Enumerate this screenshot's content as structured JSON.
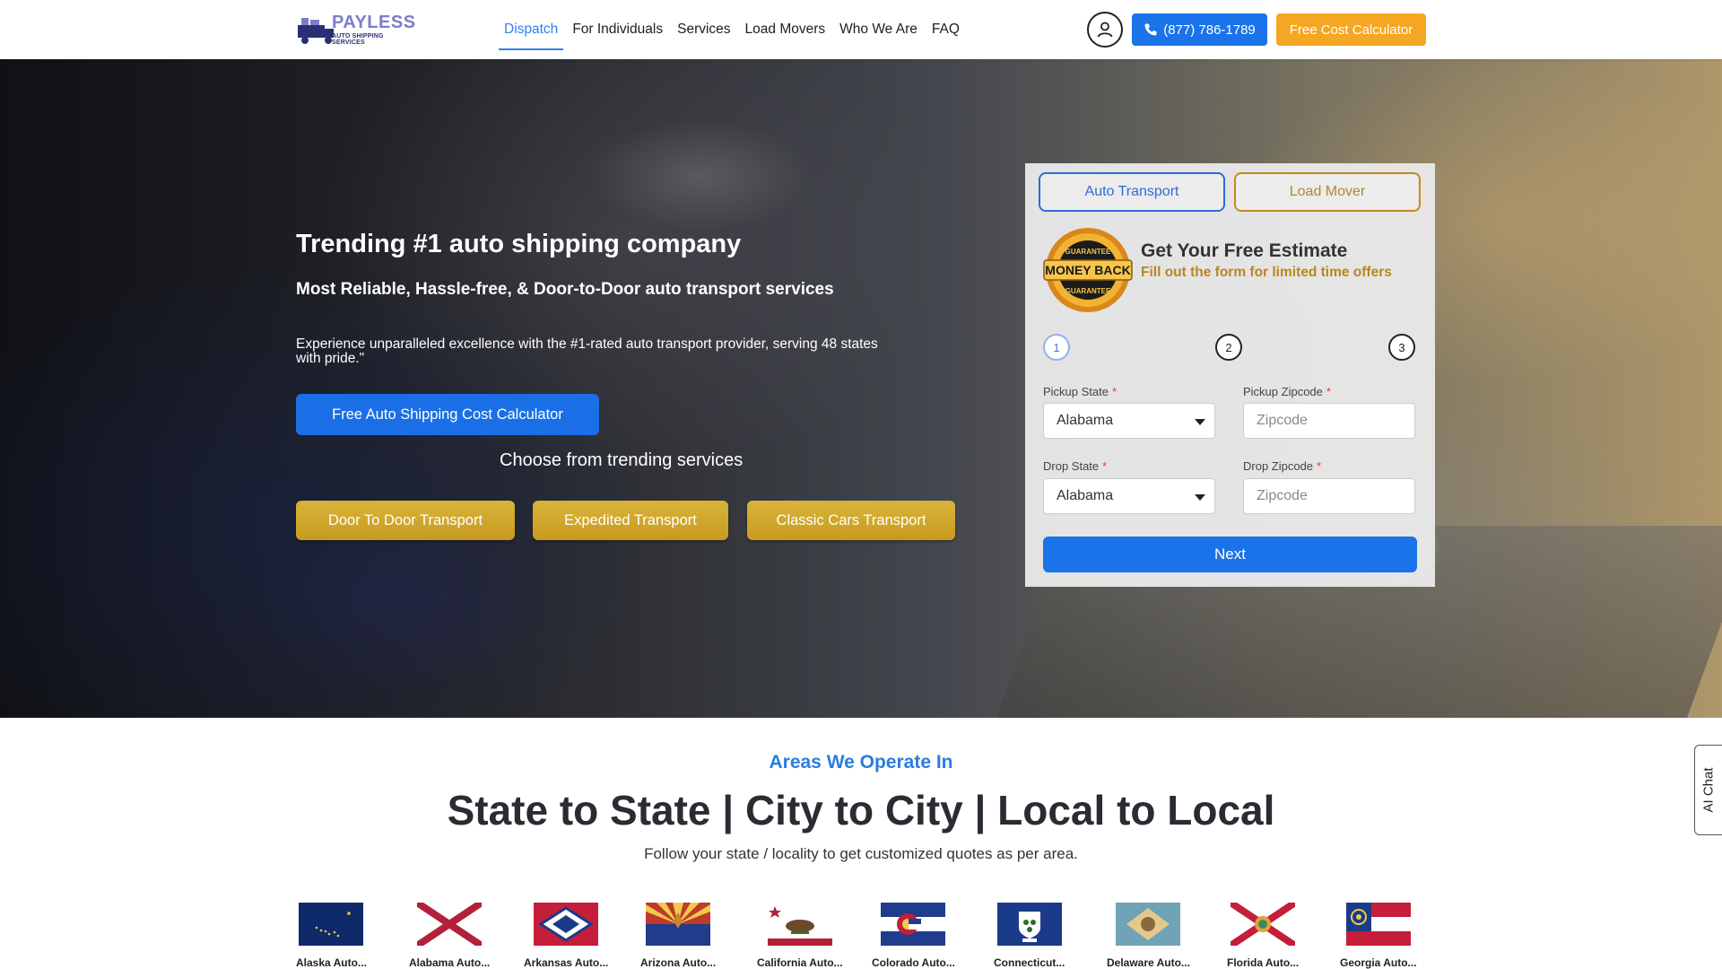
{
  "header": {
    "logo": {
      "brand": "PAYLESS",
      "tagline": "AUTO SHIPPING SERVICES"
    },
    "nav": [
      {
        "label": "Dispatch",
        "active": true
      },
      {
        "label": "For Individuals",
        "active": false
      },
      {
        "label": "Services",
        "active": false
      },
      {
        "label": "Load Movers",
        "active": false
      },
      {
        "label": "Who We Are",
        "active": false
      },
      {
        "label": "FAQ",
        "active": false
      }
    ],
    "phone_label": "(877) 786-1789",
    "calculator_label": "Free Cost Calculator",
    "colors": {
      "accent": "#1a73e8",
      "cta_orange": "#f5a623",
      "nav_active": "#2f80ed"
    }
  },
  "hero": {
    "title": "Trending #1 auto shipping company",
    "subtitle": "Most Reliable, Hassle-free, & Door-to-Door auto transport services",
    "description": "Experience unparalleled excellence with the #1-rated auto transport provider, serving 48 states with pride.\"",
    "cta_label": "Free Auto Shipping Cost Calculator",
    "choose_label": "Choose from trending services",
    "services": [
      "Door To Door Transport",
      "Expedited Transport",
      "Classic Cars Transport"
    ]
  },
  "estimate_form": {
    "tabs": [
      {
        "label": "Auto Transport",
        "active": true
      },
      {
        "label": "Load Mover",
        "active": false
      }
    ],
    "badge": {
      "top_text": "GUARANTEE",
      "main_text": "MONEY BACK",
      "bottom_text": "GUARANTEE"
    },
    "title": "Get Your Free Estimate",
    "subtitle": "Fill out the form for limited time offers",
    "steps": [
      "1",
      "2",
      "3"
    ],
    "current_step": 1,
    "fields": {
      "pickup_state": {
        "label": "Pickup State",
        "required_mark": "*",
        "value": "Alabama"
      },
      "pickup_zip": {
        "label": "Pickup Zipcode",
        "required_mark": "*",
        "placeholder": "Zipcode"
      },
      "drop_state": {
        "label": "Drop State",
        "required_mark": "*",
        "value": "Alabama"
      },
      "drop_zip": {
        "label": "Drop Zipcode",
        "required_mark": "*",
        "placeholder": "Zipcode"
      }
    },
    "next_label": "Next"
  },
  "areas": {
    "eyebrow": "Areas We Operate In",
    "title": "State to State | City to City | Local to Local",
    "description": "Follow your state / locality to get customized quotes as per area.",
    "flags": [
      {
        "label": "Alaska Auto...",
        "icon": "alaska-flag-icon"
      },
      {
        "label": "Alabama Auto...",
        "icon": "alabama-flag-icon"
      },
      {
        "label": "Arkansas Auto...",
        "icon": "arkansas-flag-icon"
      },
      {
        "label": "Arizona Auto...",
        "icon": "arizona-flag-icon"
      },
      {
        "label": "California Auto...",
        "icon": "california-flag-icon"
      },
      {
        "label": "Colorado Auto...",
        "icon": "colorado-flag-icon"
      },
      {
        "label": "Connecticut...",
        "icon": "connecticut-flag-icon"
      },
      {
        "label": "Delaware Auto...",
        "icon": "delaware-flag-icon"
      },
      {
        "label": "Florida Auto...",
        "icon": "florida-flag-icon"
      },
      {
        "label": "Georgia Auto...",
        "icon": "georgia-flag-icon"
      }
    ]
  },
  "ai_chat": {
    "label": "AI Chat"
  }
}
